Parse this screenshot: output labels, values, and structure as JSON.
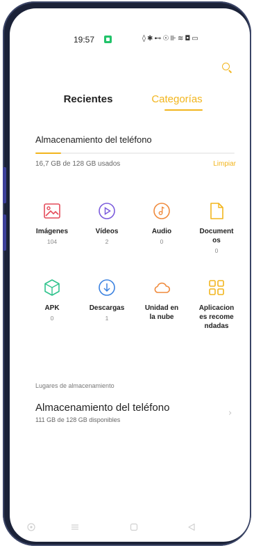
{
  "status_bar": {
    "time": "19:57",
    "icons": "◊✱⊷☉⊪≋◘▭"
  },
  "tabs": [
    {
      "label": "Recientes",
      "active": false
    },
    {
      "label": "Categorías",
      "active": true
    }
  ],
  "accent_color": "#f2b51d",
  "storage": {
    "title": "Almacenamiento del teléfono",
    "used_text": "16,7 GB de 128 GB usados",
    "used_fraction": 0.13,
    "clean_label": "Limpiar"
  },
  "categories": [
    {
      "icon": "image-icon",
      "label": "Imágenes",
      "count": "104",
      "color": "#e44b5a"
    },
    {
      "icon": "video-icon",
      "label": "Vídeos",
      "count": "2",
      "color": "#7b5bdc"
    },
    {
      "icon": "audio-icon",
      "label": "Audio",
      "count": "0",
      "color": "#f08a3c"
    },
    {
      "icon": "document-icon",
      "label": "Document os",
      "count": "0",
      "color": "#f2b51d"
    },
    {
      "icon": "apk-icon",
      "label": "APK",
      "count": "0",
      "color": "#2fc38d"
    },
    {
      "icon": "download-icon",
      "label": "Descargas",
      "count": "1",
      "color": "#3b82e0"
    },
    {
      "icon": "cloud-icon",
      "label": "Unidad en la nube",
      "count": "",
      "color": "#f08a3c"
    },
    {
      "icon": "apps-grid-icon",
      "label": "Aplicacion es recome ndadas",
      "count": "",
      "color": "#f2b51d"
    }
  ],
  "locations": {
    "heading": "Lugares de almacenamiento",
    "items": [
      {
        "title": "Almacenamiento del teléfono",
        "subtitle": "111 GB de 128 GB disponibles"
      }
    ]
  },
  "nav_bar": [
    "circle-icon",
    "menu-icon",
    "home-square-icon",
    "back-triangle-icon"
  ]
}
